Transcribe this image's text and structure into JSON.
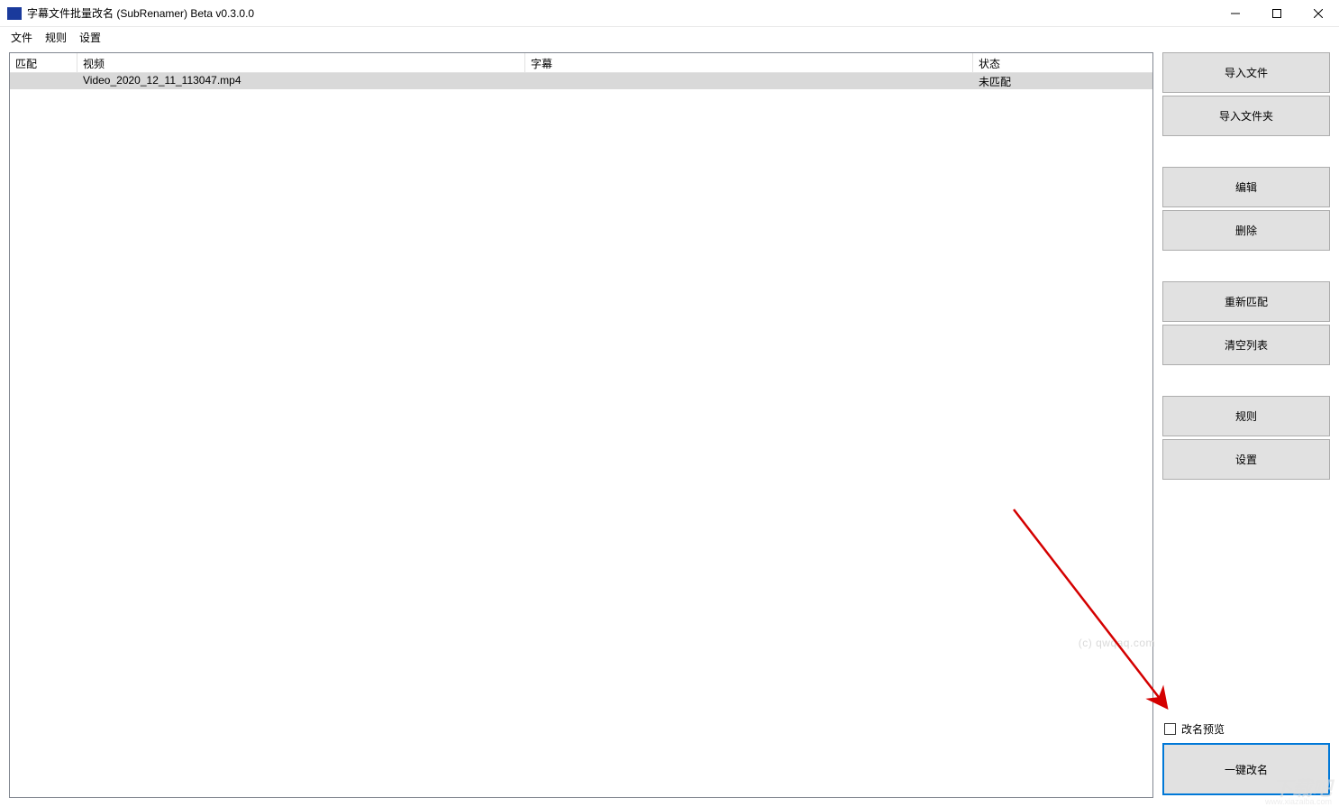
{
  "window": {
    "title": "字幕文件批量改名 (SubRenamer) Beta v0.3.0.0"
  },
  "menu": {
    "file": "文件",
    "rule": "规则",
    "settings": "设置"
  },
  "table": {
    "headers": {
      "match": "匹配",
      "video": "视频",
      "subtitle": "字幕",
      "status": "状态"
    },
    "rows": [
      {
        "match": "",
        "video": "Video_2020_12_11_113047.mp4",
        "subtitle": "",
        "status": "未匹配"
      }
    ]
  },
  "sidebar": {
    "import_file": "导入文件",
    "import_folder": "导入文件夹",
    "edit": "编辑",
    "delete": "删除",
    "rematch": "重新匹配",
    "clear_list": "清空列表",
    "rule": "规则",
    "settings": "设置",
    "preview_rename": "改名预览",
    "one_click_rename": "一键改名"
  },
  "watermarks": {
    "w1": "(c) qwqaq.com",
    "w2": "下载吧",
    "w2sub": "www.xiazaiba.com"
  }
}
